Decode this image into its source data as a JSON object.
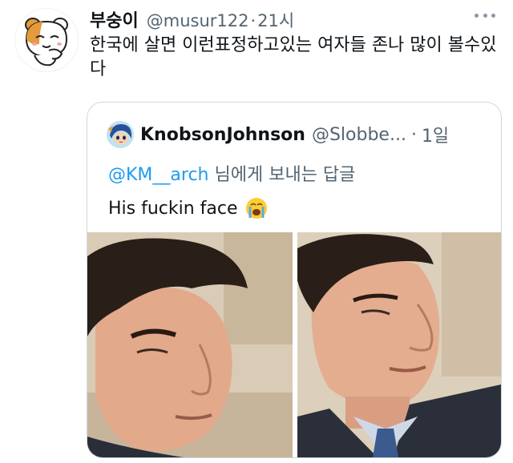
{
  "tweet": {
    "author_name": "부숭이",
    "handle": "@musur122",
    "separator": "·",
    "time": "21시",
    "text": "한국에 살면 이런표정하고있는 여자들 존나 많이 볼수있다",
    "avatar_icon": "hamster-avatar-icon",
    "more_icon": "more-options-icon"
  },
  "quote": {
    "author_name": "KnobsonJohnson",
    "handle": "@Slobbe...",
    "separator": "·",
    "time": "1일",
    "replying_mention": "@KM__arch",
    "replying_suffix": " 님에게 보내는 답글",
    "text": "His fuckin face",
    "emoji_icon": "loudly-crying-face-icon",
    "avatar_icon": "anime-character-avatar-icon"
  },
  "colors": {
    "text_primary": "#0f1419",
    "text_secondary": "#536471",
    "link": "#1d9bf0",
    "border": "#cfd9de"
  }
}
